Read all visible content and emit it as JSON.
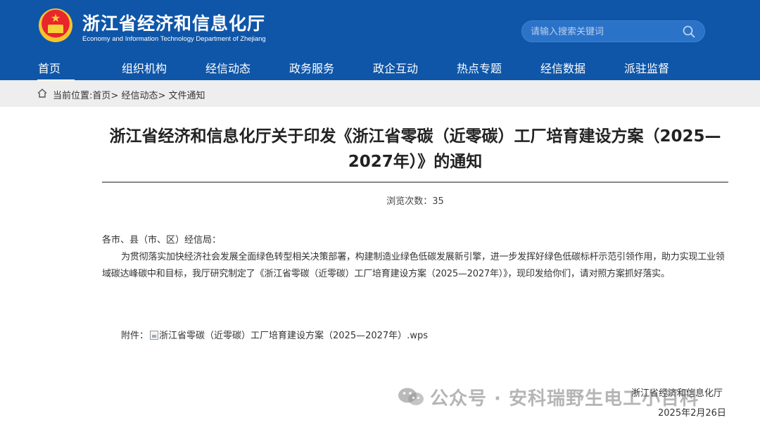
{
  "header": {
    "title": "浙江省经济和信息化厅",
    "subtitle": "Economy and Information Technology Department of Zhejiang",
    "emblem_icon": "national-emblem-icon",
    "bg_color": "#0f56a8"
  },
  "search": {
    "placeholder": "请输入搜索关键词",
    "icon": "search-icon"
  },
  "nav": {
    "items": [
      {
        "label": "首页",
        "active": true
      },
      {
        "label": "组织机构"
      },
      {
        "label": "经信动态"
      },
      {
        "label": "政务服务"
      },
      {
        "label": "政企互动"
      },
      {
        "label": "热点专题"
      },
      {
        "label": "经信数据"
      },
      {
        "label": "派驻监督"
      }
    ]
  },
  "breadcrumb": {
    "prefix": "当前位置:",
    "items": [
      "首页",
      "经信动态",
      "文件通知"
    ],
    "sep": ">"
  },
  "article": {
    "title_line1": "浙江省经济和信息化厅关于印发《浙江省零碳（近零碳）工厂培育建设方案（2025—",
    "title_line2": "2027年）》的通知",
    "views_label": "浏览次数：",
    "views_count": "35",
    "salutation": "各市、县（市、区）经信局：",
    "paragraph": "为贯彻落实加快经济社会发展全面绿色转型相关决策部署，构建制造业绿色低碳发展新引擎，进一步发挥好绿色低碳标杆示范引领作用，助力实现工业领域碳达峰碳中和目标，我厅研究制定了《浙江省零碳（近零碳）工厂培育建设方案（2025—2027年）》，现印发给你们，请对照方案抓好落实。",
    "attach_label": "附件：",
    "attach_file": "浙江省零碳（近零碳）工厂培育建设方案（2025—2027年）.wps",
    "signature": "浙江省经济和信息化厅",
    "date": "2025年2月26日"
  },
  "watermark": {
    "text": "公众号 · 安科瑞野生电工小百科",
    "icon": "wechat-icon"
  }
}
